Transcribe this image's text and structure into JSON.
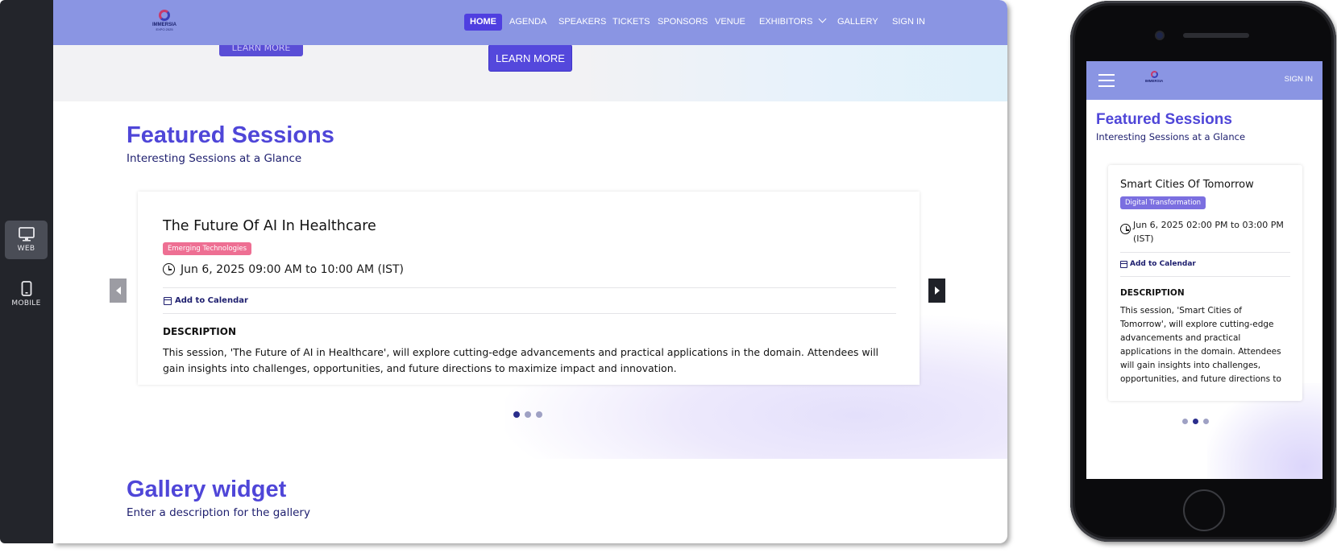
{
  "device_switcher": {
    "web_label": "WEB",
    "mobile_label": "MOBILE",
    "active": "WEB"
  },
  "web": {
    "brand": {
      "name": "IMMERSIA",
      "tagline": "EXPO 2025"
    },
    "nav": [
      {
        "label": "HOME",
        "active": true
      },
      {
        "label": "AGENDA"
      },
      {
        "label": "SPEAKERS"
      },
      {
        "label": "TICKETS"
      },
      {
        "label": "SPONSORS"
      },
      {
        "label": "VENUE"
      },
      {
        "label": "EXHIBITORS",
        "has_dropdown": true
      },
      {
        "label": "GALLERY"
      },
      {
        "label": "SIGN IN"
      }
    ],
    "hero": {
      "learn_more": "LEARN MORE"
    },
    "featured": {
      "title": "Featured Sessions",
      "subtitle": "Interesting Sessions at a Glance",
      "session": {
        "title": "The Future Of AI In Healthcare",
        "tag": "Emerging Technologies",
        "tag_color": "#ee6f93",
        "time": "Jun 6, 2025 09:00 AM to 10:00 AM (IST)",
        "add_to_calendar": "Add to Calendar",
        "description_heading": "DESCRIPTION",
        "description": "This session, 'The Future of AI in Healthcare', will explore cutting-edge advancements and practical applications in the domain. Attendees will gain insights into challenges, opportunities, and future directions to maximize impact and innovation."
      },
      "carousel": {
        "dots": 3,
        "active_index": 0
      }
    },
    "gallery": {
      "title": "Gallery widget",
      "subtitle": "Enter a description for the gallery"
    }
  },
  "mobile": {
    "sign_in": "SIGN IN",
    "brand": {
      "name": "IMMERSIA",
      "tagline": "EXPO 2025"
    },
    "featured": {
      "title": "Featured Sessions",
      "subtitle": "Interesting Sessions at a Glance",
      "session": {
        "title": "Smart Cities Of Tomorrow",
        "tag": "Digital Transformation",
        "tag_color": "#7b6fe0",
        "time": "Jun 6, 2025 02:00 PM to 03:00 PM (IST)",
        "add_to_calendar": "Add to Calendar",
        "description_heading": "DESCRIPTION",
        "description": "This session, 'Smart Cities of Tomorrow', will explore cutting-edge advancements and practical applications in the domain. Attendees will gain insights into challenges, opportunities, and future directions to"
      },
      "carousel": {
        "dots": 3,
        "active_index": 1
      }
    }
  },
  "colors": {
    "navbar": "#8a95e3",
    "accent": "#4f46d8",
    "primary_button": "#5448dc",
    "subtitle": "#1d1e6e"
  }
}
